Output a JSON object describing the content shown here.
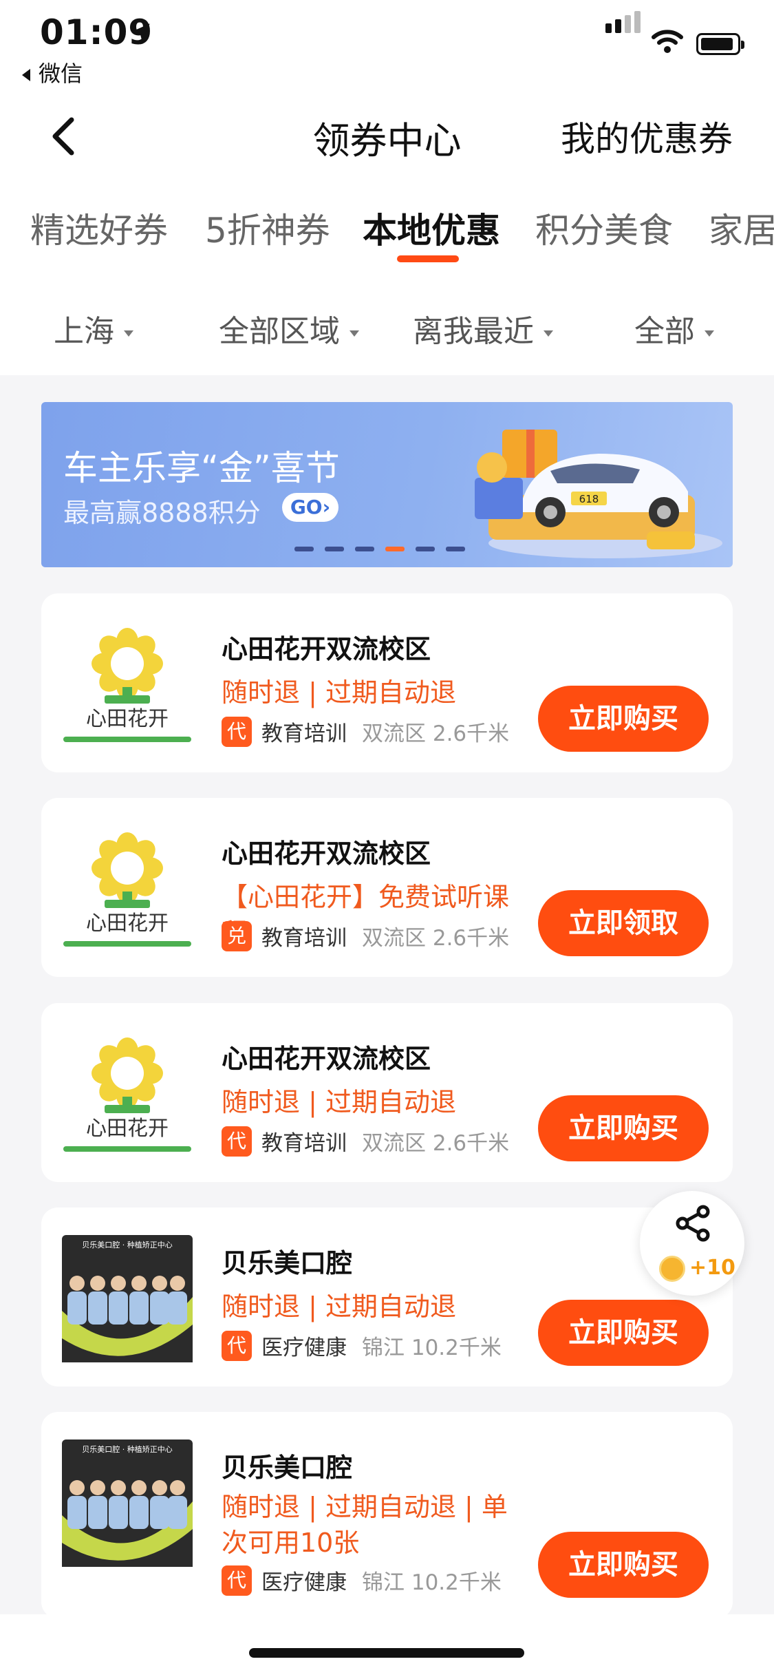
{
  "status_bar": {
    "time": "01:09",
    "back_app": "微信"
  },
  "header": {
    "title": "领券中心",
    "right_link": "我的优惠券"
  },
  "tabs": [
    {
      "label": "精选好券"
    },
    {
      "label": "5折神券"
    },
    {
      "label": "本地优惠",
      "active": true
    },
    {
      "label": "积分美食"
    },
    {
      "label": "家居"
    }
  ],
  "filters": [
    {
      "label": "上海"
    },
    {
      "label": "全部区域"
    },
    {
      "label": "离我最近"
    },
    {
      "label": "全部"
    }
  ],
  "banner": {
    "title": "车主乐享“金”喜节",
    "subtitle": "最高赢8888积分",
    "cta": "GO",
    "plate": "618",
    "page_count": 6,
    "active_page": 4
  },
  "cards": [
    {
      "title": "心田花开双流校区",
      "desc": "随时退 | 过期自动退",
      "tag": "代",
      "category": "教育培训",
      "location": "双流区 2.6千米",
      "button": "立即购买",
      "logo_text": "心田花开"
    },
    {
      "title": "心田花开双流校区",
      "desc": "【心田花开】免费试听课程",
      "tag": "兑",
      "category": "教育培训",
      "location": "双流区 2.6千米",
      "button": "立即领取",
      "logo_text": "心田花开"
    },
    {
      "title": "心田花开双流校区",
      "desc": "随时退 | 过期自动退",
      "tag": "代",
      "category": "教育培训",
      "location": "双流区 2.6千米",
      "button": "立即购买",
      "logo_text": "心田花开"
    },
    {
      "title": "贝乐美口腔",
      "desc": "随时退 | 过期自动退",
      "tag": "代",
      "category": "医疗健康",
      "location": "锦江 10.2千米",
      "button": "立即购买",
      "logo_text": "贝乐美口腔 · 种植矫正中心"
    },
    {
      "title": "贝乐美口腔",
      "desc": "随时退 | 过期自动退 | 单次可用10张",
      "tag": "代",
      "category": "医疗健康",
      "location": "锦江 10.2千米",
      "button": "立即购买",
      "logo_text": "贝乐美口腔 · 种植矫正中心"
    }
  ],
  "share_fab": {
    "reward": "+10"
  },
  "colors": {
    "accent": "#ff4d10",
    "price_text": "#f05a1e",
    "banner": "#8eb0f0"
  }
}
